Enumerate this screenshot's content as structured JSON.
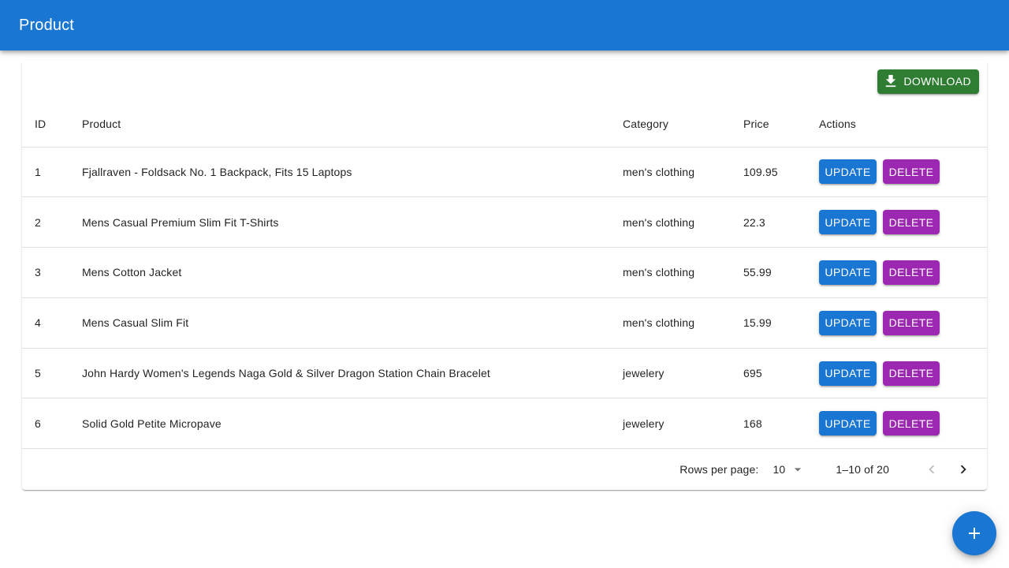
{
  "appbar": {
    "title": "Product"
  },
  "toolbar": {
    "download_label": "Download"
  },
  "table": {
    "headers": {
      "id": "ID",
      "product": "Product",
      "category": "Category",
      "price": "Price",
      "actions": "Actions"
    },
    "update_label": "Update",
    "delete_label": "Delete",
    "rows": [
      {
        "id": "1",
        "product": "Fjallraven - Foldsack No. 1 Backpack, Fits 15 Laptops",
        "category": "men's clothing",
        "price": "109.95"
      },
      {
        "id": "2",
        "product": "Mens Casual Premium Slim Fit T-Shirts",
        "category": "men's clothing",
        "price": "22.3"
      },
      {
        "id": "3",
        "product": "Mens Cotton Jacket",
        "category": "men's clothing",
        "price": "55.99"
      },
      {
        "id": "4",
        "product": "Mens Casual Slim Fit",
        "category": "men's clothing",
        "price": "15.99"
      },
      {
        "id": "5",
        "product": "John Hardy Women's Legends Naga Gold & Silver Dragon Station Chain Bracelet",
        "category": "jewelery",
        "price": "695"
      },
      {
        "id": "6",
        "product": "Solid Gold Petite Micropave",
        "category": "jewelery",
        "price": "168"
      }
    ]
  },
  "pagination": {
    "rows_per_page_label": "Rows per page:",
    "rows_per_page_value": "10",
    "range_text": "1–10 of 20"
  },
  "icons": {
    "download": "download-icon",
    "add": "add-icon",
    "prev": "chevron-left-icon",
    "next": "chevron-right-icon",
    "dropdown": "arrow-drop-down-icon"
  },
  "colors": {
    "primary": "#1976d2",
    "success": "#2e7d32",
    "secondary": "#9c27b0"
  }
}
